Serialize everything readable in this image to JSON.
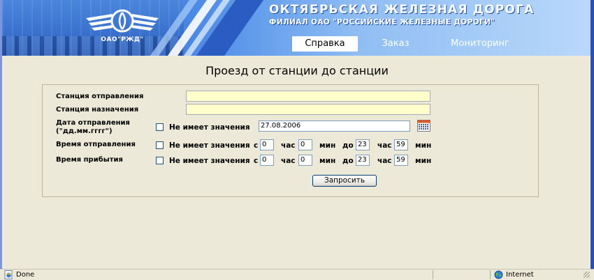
{
  "header": {
    "logo_caption": "ОАО\"РЖД\"",
    "title": "ОКТЯБРЬСКАЯ ЖЕЛЕЗНАЯ ДОРОГА",
    "subtitle": "ФИЛИАЛ ОАО \"РОССИЙСКИЕ ЖЕЛЕЗНЫЕ ДОРОГИ\"",
    "tabs": [
      {
        "label": "Справка",
        "active": true
      },
      {
        "label": "Заказ",
        "active": false
      },
      {
        "label": "Мониторинг",
        "active": false
      }
    ]
  },
  "page": {
    "title": "Проезд от станции до станции"
  },
  "form": {
    "departure_station": {
      "label": "Станция отправления",
      "value": ""
    },
    "arrival_station": {
      "label": "Станция назначения",
      "value": ""
    },
    "departure_date": {
      "label_line1": "Дата отправления",
      "label_line2": "(\"дд.мм.гггг\")",
      "no_value_label": "Не имеет значения",
      "value": "27.08.2006"
    },
    "departure_time": {
      "label": "Время отправления",
      "no_value_label": "Не имеет значения",
      "from": "с",
      "from_hour": "0",
      "hour_unit": "час",
      "from_min": "0",
      "min_unit": "мин",
      "to": "до",
      "to_hour": "23",
      "to_min": "59"
    },
    "arrival_time": {
      "label": "Время прибытия",
      "no_value_label": "Не имеет значения",
      "from": "с",
      "from_hour": "0",
      "hour_unit": "час",
      "from_min": "0",
      "min_unit": "мин",
      "to": "до",
      "to_hour": "23",
      "to_min": "59"
    },
    "submit_label": "Запросить"
  },
  "statusbar": {
    "status": "Done",
    "zone": "Internet"
  },
  "colors": {
    "input_highlight": "#ffffcc",
    "header_blue": "#2e67c9",
    "page_bg": "#ece9d8"
  }
}
